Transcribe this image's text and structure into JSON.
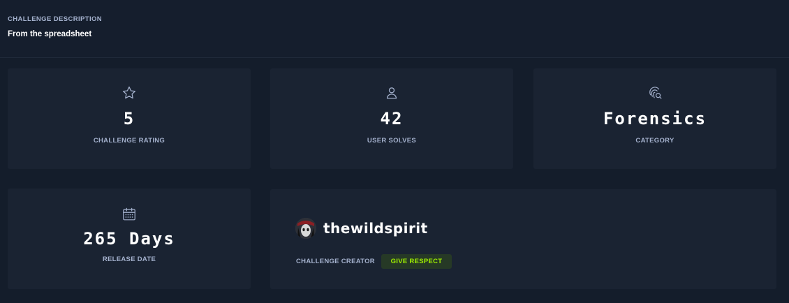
{
  "description": {
    "label": "CHALLENGE DESCRIPTION",
    "text": "From the spreadsheet"
  },
  "stats": {
    "rating": {
      "icon": "star-icon",
      "value": "5",
      "label": "CHALLENGE RATING"
    },
    "solves": {
      "icon": "user-icon",
      "value": "42",
      "label": "USER SOLVES"
    },
    "category": {
      "icon": "fingerprint-search-icon",
      "value": "Forensics",
      "label": "CATEGORY"
    },
    "release": {
      "icon": "calendar-icon",
      "value": "265 Days",
      "label": "RELEASE DATE"
    }
  },
  "creator": {
    "name": "thewildspirit",
    "label": "CHALLENGE CREATOR",
    "respect_label": "GIVE RESPECT"
  },
  "colors": {
    "background": "#141d2b",
    "card": "#1a2332",
    "label": "#a4b1cd",
    "accent_green": "#9fef00",
    "respect_bg": "#263926"
  }
}
